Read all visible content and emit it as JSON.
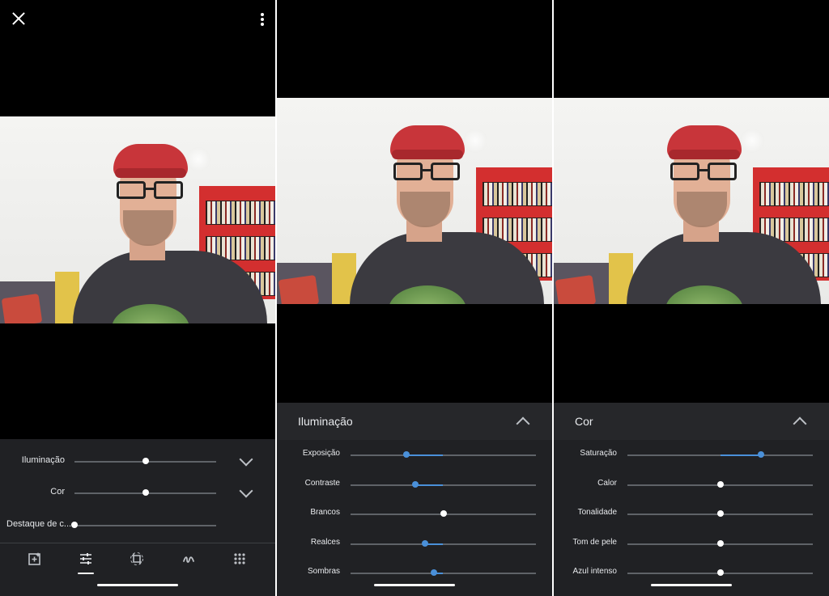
{
  "colors": {
    "background": "#000000",
    "sheet": "#202124",
    "accent": "#4a90d9",
    "track": "#5f6368"
  },
  "panel1": {
    "close_icon": "close-icon",
    "more_icon": "more-vert-icon",
    "sliders": [
      {
        "label": "Iluminação",
        "value": 0.5,
        "expandable": true
      },
      {
        "label": "Cor",
        "value": 0.5,
        "expandable": true
      },
      {
        "label": "Destaque de c...",
        "value": 0.0,
        "expandable": false
      }
    ],
    "tools": [
      "suggestions-icon",
      "adjust-icon",
      "crop-rotate-icon",
      "markup-icon",
      "more-tools-icon"
    ],
    "active_tool": "adjust-icon"
  },
  "panel2": {
    "title": "Iluminação",
    "sliders": [
      {
        "label": "Exposição",
        "value": 0.3,
        "center": 0.5
      },
      {
        "label": "Contraste",
        "value": 0.35,
        "center": 0.5
      },
      {
        "label": "Brancos",
        "value": 0.5,
        "center": 0.5
      },
      {
        "label": "Realces",
        "value": 0.4,
        "center": 0.5
      },
      {
        "label": "Sombras",
        "value": 0.45,
        "center": 0.5
      }
    ]
  },
  "panel3": {
    "title": "Cor",
    "sliders": [
      {
        "label": "Saturação",
        "value": 0.72,
        "center": 0.5
      },
      {
        "label": "Calor",
        "value": 0.5,
        "center": 0.5
      },
      {
        "label": "Tonalidade",
        "value": 0.5,
        "center": 0.5
      },
      {
        "label": "Tom de pele",
        "value": 0.5,
        "center": 0.5
      },
      {
        "label": "Azul intenso",
        "value": 0.5,
        "center": 0.5
      }
    ]
  }
}
